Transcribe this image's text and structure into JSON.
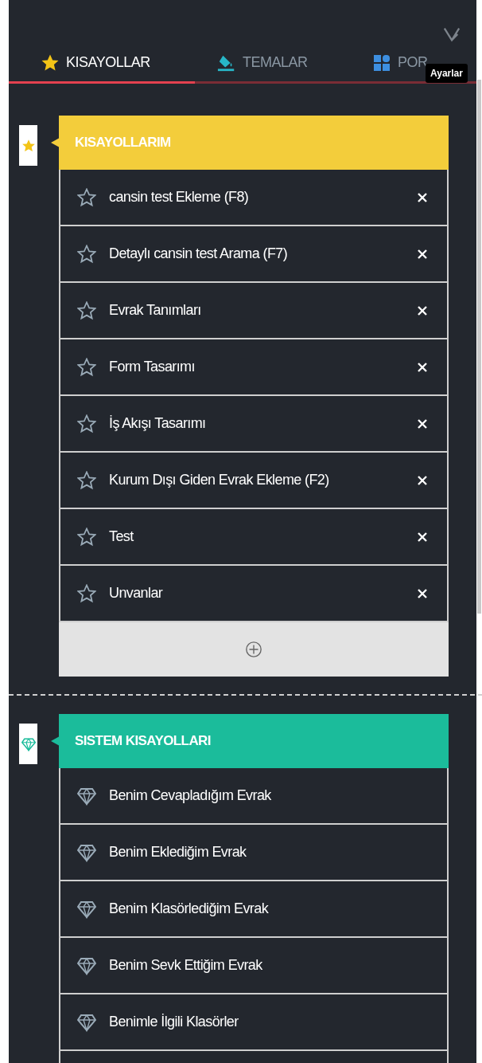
{
  "tabs": [
    {
      "label": "KISAYOLLAR",
      "kind": "star",
      "selected": true
    },
    {
      "label": "TEMALAR",
      "kind": "bucket",
      "selected": false
    },
    {
      "label": "POR",
      "kind": "grid",
      "selected": false
    }
  ],
  "tooltip": "Ayarlar",
  "sections": [
    {
      "title": "KISAYOLLARIM",
      "kind": "favorites",
      "color": "#f3cd3b",
      "items": [
        {
          "label": "cansin test Ekleme (F8)"
        },
        {
          "label": "Detaylı cansin test Arama (F7)"
        },
        {
          "label": "Evrak Tanımları"
        },
        {
          "label": "Form Tasarımı"
        },
        {
          "label": "İş Akışı Tasarımı"
        },
        {
          "label": "Kurum Dışı Giden Evrak Ekleme (F2)"
        },
        {
          "label": "Test"
        },
        {
          "label": "Unvanlar"
        }
      ]
    },
    {
      "title": "SISTEM KISAYOLLARI",
      "kind": "system",
      "color": "#1bbc9b",
      "items": [
        {
          "label": "Benim Cevapladığım Evrak"
        },
        {
          "label": "Benim Eklediğim Evrak"
        },
        {
          "label": "Benim Klasörlediğim Evrak"
        },
        {
          "label": "Benim Sevk Ettiğim Evrak"
        },
        {
          "label": "Benimle İlgili Klasörler"
        }
      ]
    }
  ]
}
